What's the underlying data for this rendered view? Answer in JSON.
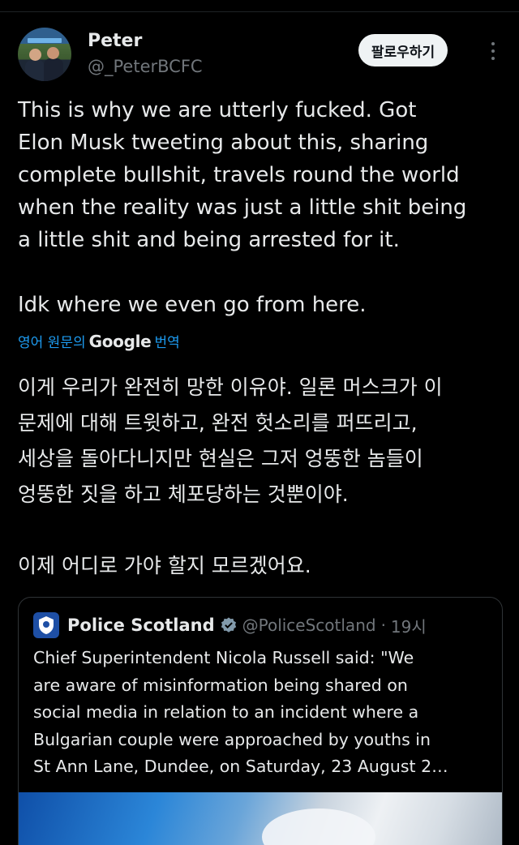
{
  "tweet": {
    "author": {
      "display_name": "Peter",
      "handle": "@_PeterBCFC",
      "avatar_icon": "profile-photo"
    },
    "follow_label": "팔로우하기",
    "more_icon": "more-vertical-icon",
    "text": "This is why we are utterly fucked. Got\nElon Musk tweeting about this, sharing\ncomplete bullshit, travels round the world\nwhen the reality was just a little shit being\na little shit and being arrested for it.\n\nIdk where we even go from here.",
    "translate": {
      "prefix": "영어 원문의",
      "brand": "Google",
      "suffix": "번역"
    },
    "translated_text": "이게 우리가 완전히 망한 이유야. 일론 머스크가 이\n문제에 대해 트윗하고, 완전 헛소리를 퍼뜨리고,\n세상을 돌아다니지만 현실은 그저 엉뚱한 놈들이\n엉뚱한 짓을 하고 체포당하는 것뿐이야.\n\n이제 어디로 가야 할지 모르겠어요."
  },
  "quote": {
    "name": "Police Scotland",
    "handle": "@PoliceScotland",
    "separator": "·",
    "time": "19시",
    "verified_icon": "verified-badge-icon",
    "text": "Chief Superintendent Nicola Russell said: \"We\nare aware of misinformation being shared on\nsocial media in relation to an incident where a\nBulgarian couple were approached by youths in\nSt Ann Lane, Dundee, on Saturday, 23 August 2…"
  },
  "colors": {
    "background": "#000000",
    "text": "#e7e9ea",
    "secondary_text": "#71767b",
    "link": "#1d9bf0",
    "follow_button_bg": "#eff3f4",
    "police_blue": "#1e4fa5"
  }
}
